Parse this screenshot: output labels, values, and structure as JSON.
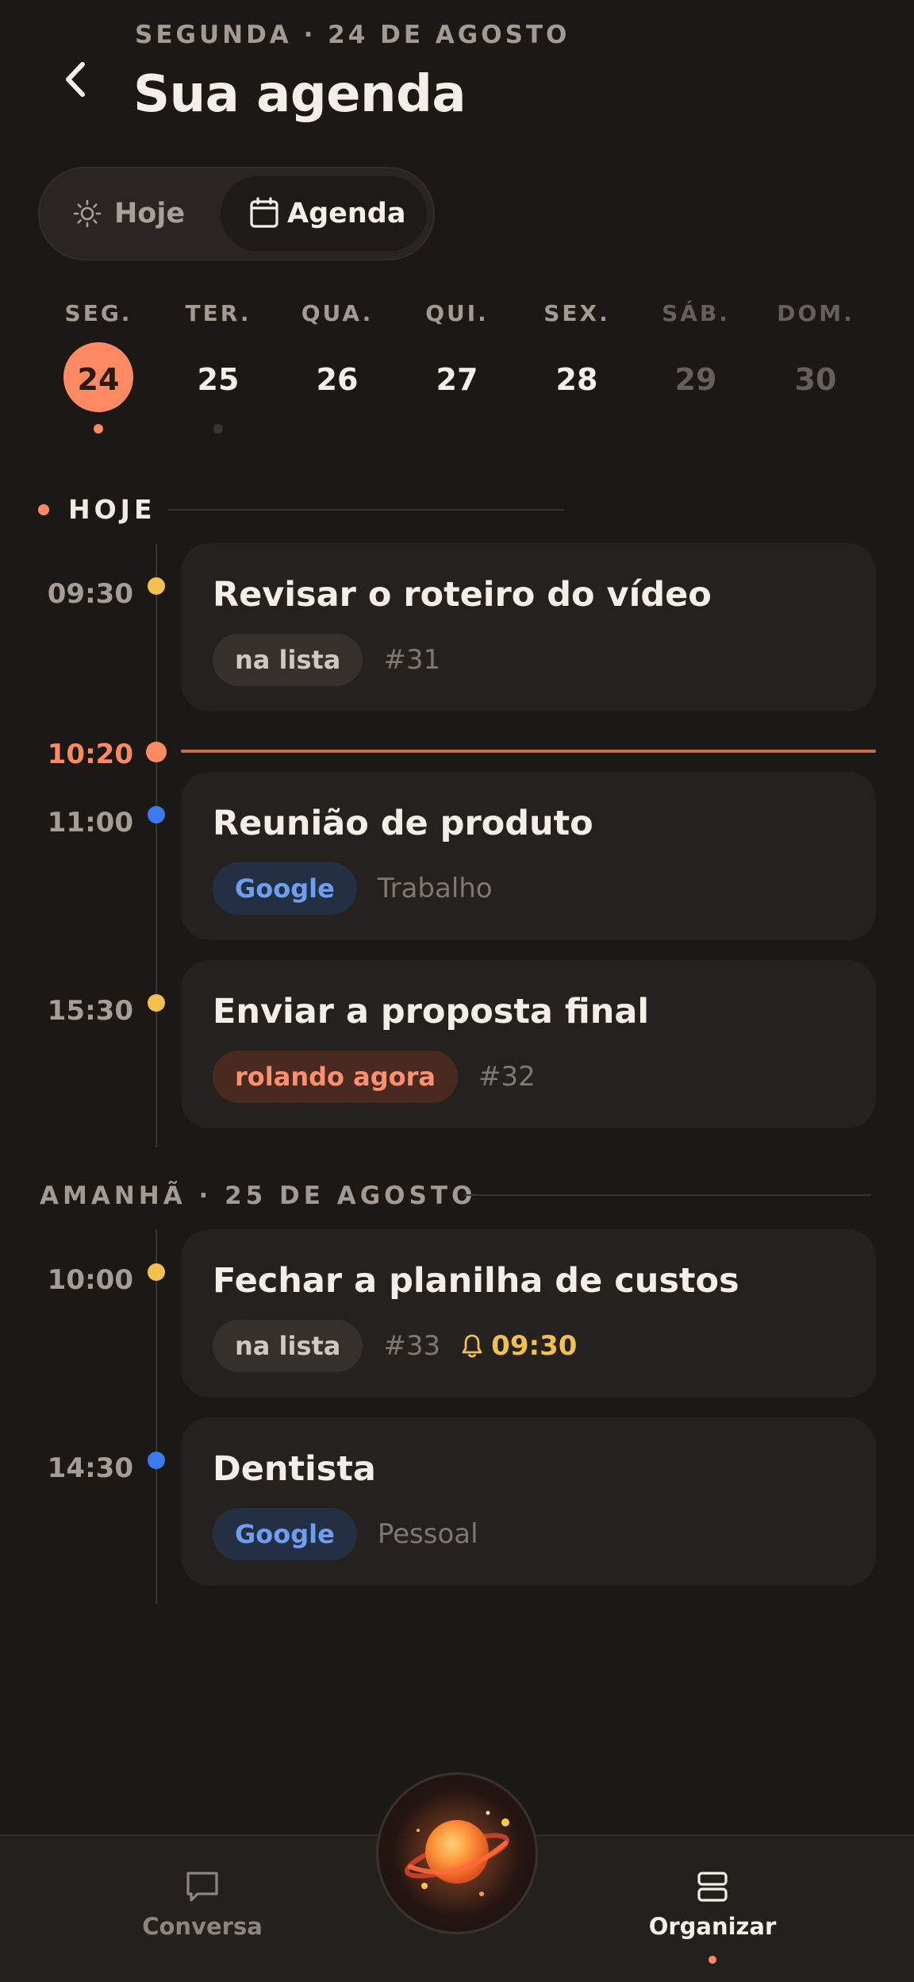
{
  "header": {
    "date_line": "SEGUNDA · 24 DE AGOSTO",
    "title": "Sua agenda"
  },
  "toggle": {
    "hoje_label": "Hoje",
    "agenda_label": "Agenda",
    "selected": "Agenda"
  },
  "week": {
    "days": [
      {
        "label": "SEG.",
        "num": "24",
        "selected": true
      },
      {
        "label": "TER.",
        "num": "25"
      },
      {
        "label": "QUA.",
        "num": "26"
      },
      {
        "label": "QUI.",
        "num": "27"
      },
      {
        "label": "SEX.",
        "num": "28"
      },
      {
        "label": "SÁB.",
        "num": "29",
        "dimmed": true
      },
      {
        "label": "DOM.",
        "num": "30",
        "dimmed": true
      }
    ]
  },
  "sections": {
    "today_label": "HOJE",
    "tomorrow_label": "AMANHÃ · 25 DE AGOSTO"
  },
  "now": {
    "time": "10:20"
  },
  "events": [
    {
      "time": "09:30",
      "title": "Revisar o roteiro do vídeo",
      "tag": "na lista",
      "meta": "#31",
      "dot_color": "#f2c04e"
    },
    {
      "time": "11:00",
      "title": "Reunião de produto",
      "tag": "Google",
      "meta": "Trabalho",
      "dot_color": "#3b7bf0"
    },
    {
      "time": "15:30",
      "title": "Enviar a proposta final",
      "tag": "rolando agora",
      "meta": "#32",
      "dot_color": "#f2c04e"
    },
    {
      "time": "10:00",
      "title": "Fechar a planilha de custos",
      "tag": "na lista",
      "meta": "#33",
      "reminder": "09:30",
      "dot_color": "#f2c04e"
    },
    {
      "time": "14:30",
      "title": "Dentista",
      "tag": "Google",
      "meta": "Pessoal",
      "dot_color": "#3b7bf0"
    }
  ],
  "nav": {
    "conversa_label": "Conversa",
    "organizar_label": "Organizar"
  },
  "colors": {
    "accent": "#ff8a64",
    "background": "#1b1816",
    "card": "#25211e",
    "reminder": "#f2c04e",
    "google_blue": "#3b7bf0"
  },
  "icons": {
    "back": "chevron-left-icon",
    "hoje": "sun-icon",
    "agenda": "calendar-icon",
    "reminder": "bell-icon",
    "conversa": "chat-bubble-icon",
    "organizar": "stack-icon",
    "assistant": "planet-icon"
  }
}
